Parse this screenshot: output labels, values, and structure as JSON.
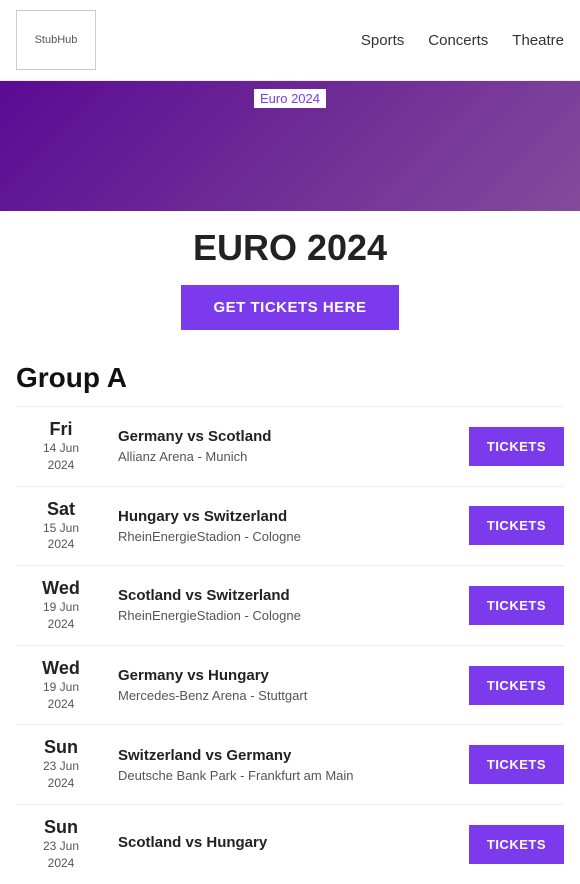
{
  "header": {
    "logo_text": "StubHub",
    "nav": [
      {
        "label": "Sports",
        "id": "sports"
      },
      {
        "label": "Concerts",
        "id": "concerts"
      },
      {
        "label": "Theatre",
        "id": "theatre"
      }
    ]
  },
  "breadcrumb": "Euro 2024",
  "hero": {
    "background": "#7c3aed"
  },
  "title_section": {
    "page_title": "EURO 2024",
    "cta_label": "GET TICKETS HERE"
  },
  "groups": [
    {
      "group_name": "Group A",
      "events": [
        {
          "day": "Fri",
          "date_line1": "14 Jun",
          "date_line2": "2024",
          "matchup": "Germany vs Scotland",
          "venue": "Allianz Arena - Munich",
          "ticket_label": "TICKETS"
        },
        {
          "day": "Sat",
          "date_line1": "15 Jun",
          "date_line2": "2024",
          "matchup": "Hungary vs Switzerland",
          "venue": "RheinEnergieStadion - Cologne",
          "ticket_label": "TICKETS"
        },
        {
          "day": "Wed",
          "date_line1": "19 Jun",
          "date_line2": "2024",
          "matchup": "Scotland vs Switzerland",
          "venue": "RheinEnergieStadion - Cologne",
          "ticket_label": "TICKETS"
        },
        {
          "day": "Wed",
          "date_line1": "19 Jun",
          "date_line2": "2024",
          "matchup": "Germany vs Hungary",
          "venue": "Mercedes-Benz Arena - Stuttgart",
          "ticket_label": "TICKETS"
        },
        {
          "day": "Sun",
          "date_line1": "23 Jun",
          "date_line2": "2024",
          "matchup": "Switzerland vs Germany",
          "venue": "Deutsche Bank Park - Frankfurt am Main",
          "ticket_label": "TICKETS"
        },
        {
          "day": "Sun",
          "date_line1": "23 Jun",
          "date_line2": "2024",
          "matchup": "Scotland vs Hungary",
          "venue": "",
          "ticket_label": "TICKETS"
        }
      ]
    }
  ]
}
